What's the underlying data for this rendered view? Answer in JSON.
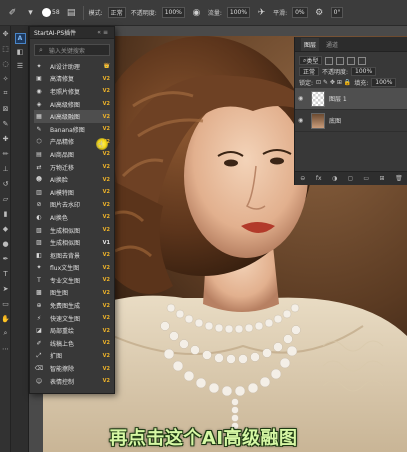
{
  "options_bar": {
    "brush_size": "58",
    "mode_label": "模式:",
    "mode_value": "正常",
    "opacity_label": "不透明度:",
    "opacity_value": "100%",
    "flow_label": "流量:",
    "flow_value": "100%",
    "smoothing_label": "平滑:",
    "smoothing_value": "0%",
    "angle_value": "0°"
  },
  "plugin_panel": {
    "title": "StartAI-PS插件",
    "search_placeholder": "输入关键搜索",
    "items": [
      {
        "icon": "ai-star-icon",
        "glyph": "✦",
        "label": "AI设计助理",
        "badge": "👑",
        "badge_class": ""
      },
      {
        "icon": "hd-icon",
        "glyph": "▣",
        "label": "高清修复",
        "badge": "V2",
        "badge_class": ""
      },
      {
        "icon": "photo-repair-icon",
        "glyph": "◉",
        "label": "老照片修复",
        "badge": "V2",
        "badge_class": ""
      },
      {
        "icon": "ai-high-res-icon",
        "glyph": "◈",
        "label": "AI高级修图",
        "badge": "V2",
        "badge_class": ""
      },
      {
        "icon": "ai-fusion-icon",
        "glyph": "▦",
        "label": "AI高级融图",
        "badge": "V2",
        "badge_class": ""
      },
      {
        "icon": "banana-icon",
        "glyph": "✎",
        "label": "Banana修图",
        "badge": "V2",
        "badge_class": ""
      },
      {
        "icon": "product-icon",
        "glyph": "⬡",
        "label": "产品精修",
        "badge": "V2",
        "badge_class": ""
      },
      {
        "icon": "ai-product-icon",
        "glyph": "▤",
        "label": "AI商品图",
        "badge": "V2",
        "badge_class": ""
      },
      {
        "icon": "transfer-icon",
        "glyph": "⇄",
        "label": "万物迁移",
        "badge": "V2",
        "badge_class": ""
      },
      {
        "icon": "ai-model-icon",
        "glyph": "☻",
        "label": "AI换脸",
        "badge": "V2",
        "badge_class": ""
      },
      {
        "icon": "ai-template-icon",
        "glyph": "▥",
        "label": "AI模特图",
        "badge": "V2",
        "badge_class": ""
      },
      {
        "icon": "watermark-icon",
        "glyph": "⊘",
        "label": "图片去水印",
        "badge": "V2",
        "badge_class": ""
      },
      {
        "icon": "ai-color-icon",
        "glyph": "◐",
        "label": "AI换色",
        "badge": "V2",
        "badge_class": ""
      },
      {
        "icon": "similar-1-icon",
        "glyph": "▧",
        "label": "生成相似图",
        "badge": "V2",
        "badge_class": ""
      },
      {
        "icon": "similar-2-icon",
        "glyph": "▨",
        "label": "生成相似图",
        "badge": "V1",
        "badge_class": "v1"
      },
      {
        "icon": "remove-bg-icon",
        "glyph": "◧",
        "label": "抠图去背景",
        "badge": "V2",
        "badge_class": ""
      },
      {
        "icon": "flux-icon",
        "glyph": "✦",
        "label": "flux文生图",
        "badge": "V2",
        "badge_class": ""
      },
      {
        "icon": "text2img-icon",
        "glyph": "T",
        "label": "专业文生图",
        "badge": "V2",
        "badge_class": ""
      },
      {
        "icon": "image2img-icon",
        "glyph": "▩",
        "label": "图生图",
        "badge": "V2",
        "badge_class": ""
      },
      {
        "icon": "free-gen-icon",
        "glyph": "⊕",
        "label": "免费图生成",
        "badge": "V2",
        "badge_class": ""
      },
      {
        "icon": "fast-text-icon",
        "glyph": "⚡",
        "label": "快速文生图",
        "badge": "V2",
        "badge_class": ""
      },
      {
        "icon": "local-redraw-icon",
        "glyph": "◪",
        "label": "局部重绘",
        "badge": "V2",
        "badge_class": ""
      },
      {
        "icon": "lineart-icon",
        "glyph": "✐",
        "label": "线稿上色",
        "badge": "V2",
        "badge_class": ""
      },
      {
        "icon": "expand-icon",
        "glyph": "⤢",
        "label": "扩图",
        "badge": "V2",
        "badge_class": ""
      },
      {
        "icon": "smart-erase-icon",
        "glyph": "⌫",
        "label": "智能擦除",
        "badge": "V2",
        "badge_class": ""
      },
      {
        "icon": "expression-icon",
        "glyph": "☺",
        "label": "表情控制",
        "badge": "V2",
        "badge_class": ""
      }
    ]
  },
  "layers_panel": {
    "tabs": [
      "图层",
      "通道"
    ],
    "kind_label": "类型",
    "blend_mode": "正常",
    "opacity_label": "不透明度:",
    "opacity_value": "100%",
    "lock_label": "锁定:",
    "fill_label": "填充:",
    "fill_value": "100%",
    "layers": [
      {
        "name": "图层 1",
        "selected": true
      },
      {
        "name": "底图",
        "selected": false
      }
    ],
    "footer": [
      "⊖",
      "fx",
      "◑",
      "◻",
      "▭",
      "⊞",
      "🗑"
    ]
  },
  "caption": "再点击这个AI高级融图",
  "colors": {
    "accent_badge": "#f0b429",
    "caption_fill": "#d6f7a4",
    "panel_bg": "#383838"
  }
}
